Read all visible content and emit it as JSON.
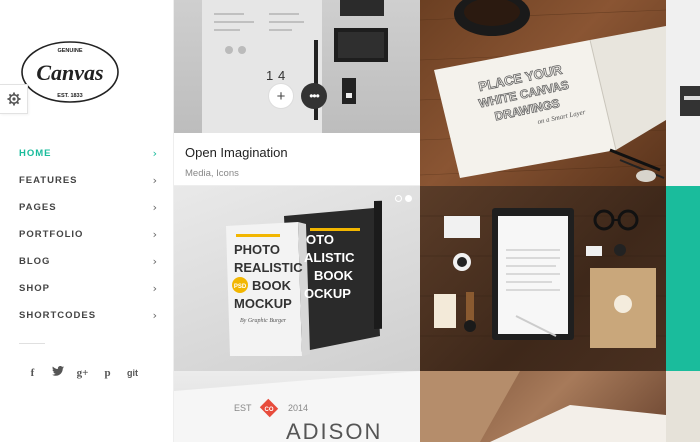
{
  "brand": {
    "top_text": "GENUINE",
    "name": "Canvas",
    "bottom_text": "EST. 1833"
  },
  "nav": {
    "items": [
      {
        "label": "HOME",
        "active": true
      },
      {
        "label": "FEATURES",
        "active": false
      },
      {
        "label": "PAGES",
        "active": false
      },
      {
        "label": "PORTFOLIO",
        "active": false
      },
      {
        "label": "BLOG",
        "active": false
      },
      {
        "label": "SHOP",
        "active": false
      },
      {
        "label": "SHORTCODES",
        "active": false
      }
    ],
    "chevron": "›"
  },
  "social": {
    "facebook": "f",
    "twitter": "t",
    "gplus": "g+",
    "pinterest": "p",
    "github": "git"
  },
  "portfolio": {
    "featured": {
      "title": "Open Imagination",
      "categories": "Media, Icons",
      "plus": "+",
      "more": "•••"
    },
    "sketchbook_text": [
      "PLACE YOUR",
      "WHITE CANVAS",
      "DRAWINGS",
      "on a Smart Layer"
    ],
    "book": {
      "lines": [
        "PHOTO",
        "REALISTIC",
        "BOOK",
        "MOCKUP"
      ],
      "badge": "PSD",
      "byline": "By Graphic Burger"
    },
    "card": {
      "est": "EST",
      "year": "2014",
      "badge": "CO",
      "name": "ADISON"
    }
  },
  "colors": {
    "accent": "#1abc9c",
    "nav_text": "#444444"
  }
}
